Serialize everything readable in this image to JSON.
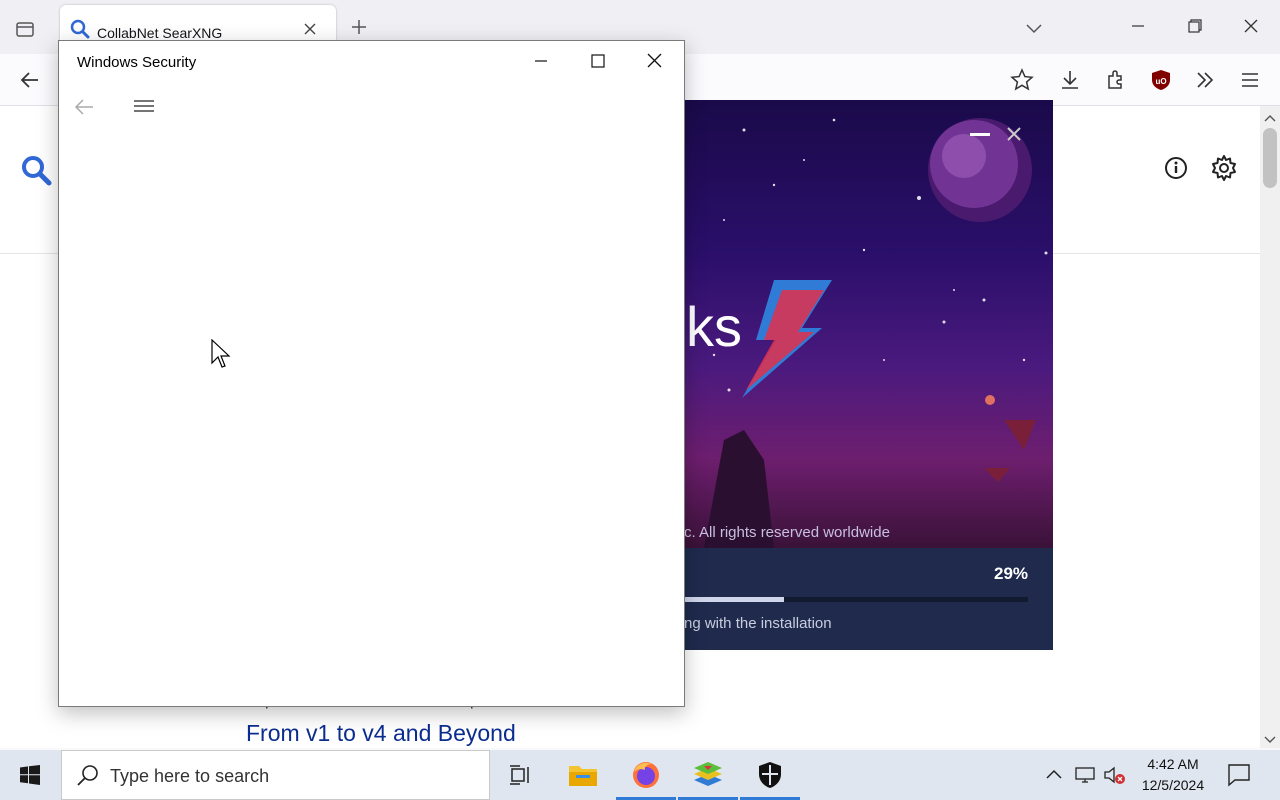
{
  "browser": {
    "tab_title": "CollabNet SearXNG"
  },
  "page": {
    "result_url": "https://www.bluestacks.com › previous-versions.html",
    "result_title": "From v1 to v4 and Beyond"
  },
  "installer": {
    "brand_text": "ks",
    "copyright": "c. All rights reserved worldwide",
    "progress_text": "29%",
    "progress_value": 0.29,
    "status_text": "ng with the installation"
  },
  "windows_security": {
    "title": "Windows Security"
  },
  "taskbar": {
    "search_placeholder": "Type here to search",
    "time": "4:42 AM",
    "date": "12/5/2024"
  },
  "colors": {
    "accent": "#2f7bd6",
    "link": "#0b2d8f",
    "installer_bottom": "#1f2a4d"
  }
}
